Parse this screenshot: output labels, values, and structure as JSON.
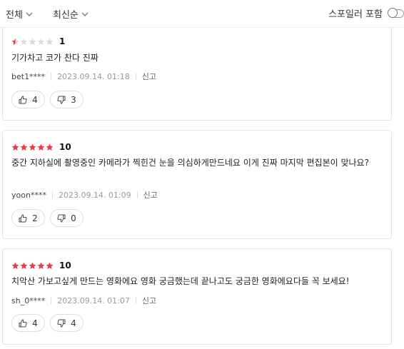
{
  "filters": {
    "all_label": "전체",
    "sort_label": "최신순"
  },
  "spoiler": {
    "label": "스포일러 포함"
  },
  "reviews": [
    {
      "rating": 1,
      "score": "1",
      "text": "기가차고 코가 찬다 진짜",
      "user": "bet1****",
      "date": "2023.09.14. 01:18",
      "report": "신고",
      "likes": "4",
      "dislikes": "3"
    },
    {
      "rating": 10,
      "score": "10",
      "text": "중간 지하실에 촬영중인 카메라가 찍힌건 눈을 의심하게만드네요 이게 진짜 마지막 편집본이 맞나요?",
      "user": "yoon****",
      "date": "2023.09.14. 01:09",
      "report": "신고",
      "likes": "2",
      "dislikes": "0"
    },
    {
      "rating": 10,
      "score": "10",
      "text": "치악산 가보고싶게 만드는 영화에요 영화 궁금했는데 끝나고도 궁금한 영화에요다들 꼭 보세요!",
      "user": "sh_0****",
      "date": "2023.09.14. 01:07",
      "report": "신고",
      "likes": "4",
      "dislikes": "4"
    }
  ],
  "colors": {
    "star_filled": "#ef3b49",
    "star_empty": "#dcdcdc"
  }
}
